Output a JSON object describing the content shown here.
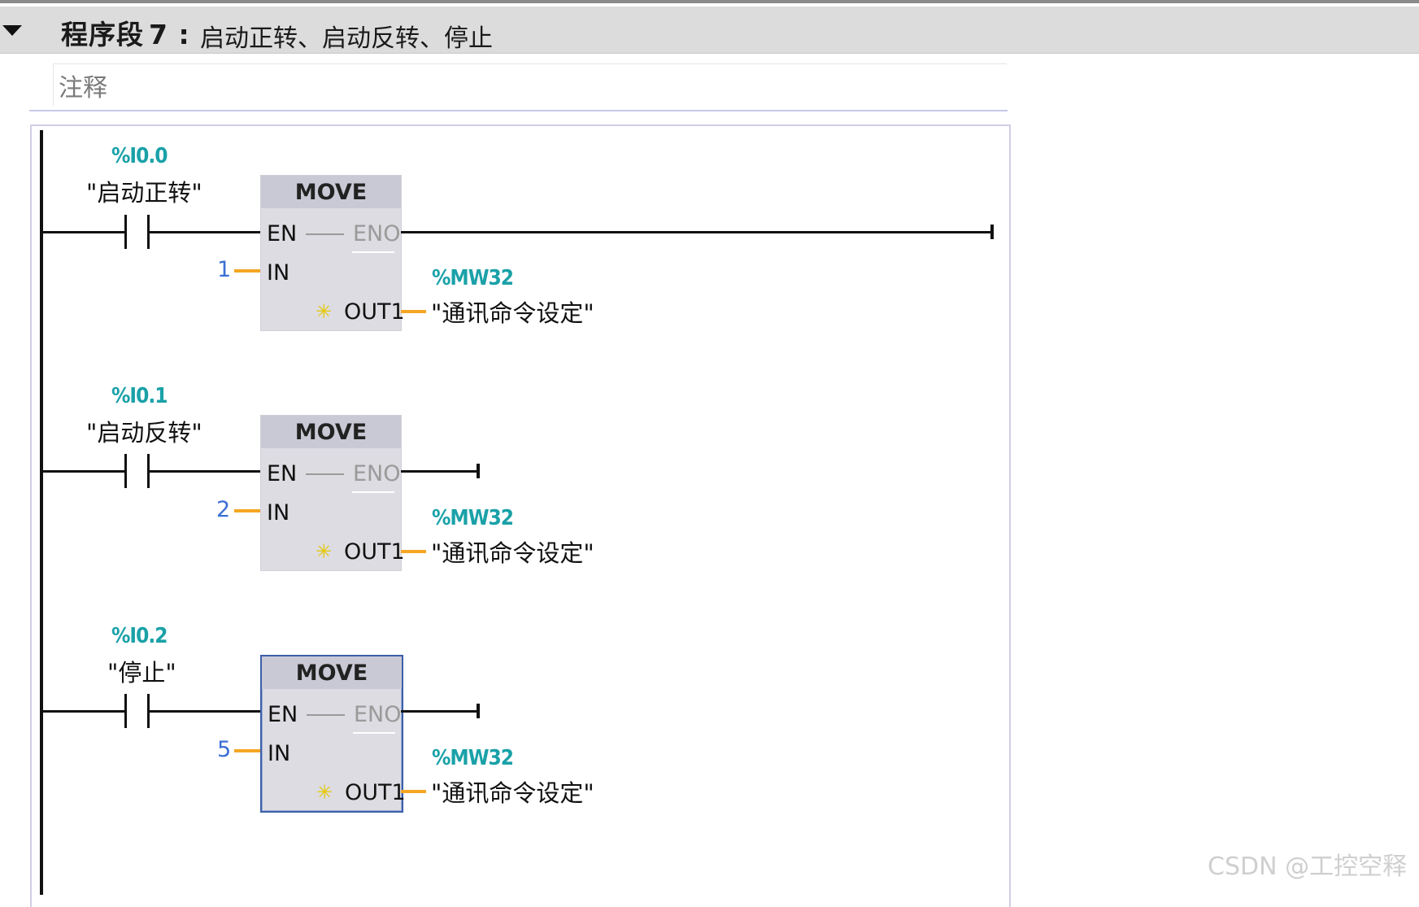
{
  "header": {
    "title": "程序段",
    "number": "7 :",
    "description": "启动正转、启动反转、停止"
  },
  "comment": {
    "label": "注释"
  },
  "rungs": [
    {
      "contact_address": "%I0.0",
      "contact_symbol": "\"启动正转\"",
      "block_title": "MOVE",
      "pin_en": "EN",
      "pin_eno": "ENO",
      "pin_in": "IN",
      "pin_out": "OUT1",
      "in_value": "1",
      "out_address": "%MW32",
      "out_symbol": "\"通讯命令设定\""
    },
    {
      "contact_address": "%I0.1",
      "contact_symbol": "\"启动反转\"",
      "block_title": "MOVE",
      "pin_en": "EN",
      "pin_eno": "ENO",
      "pin_in": "IN",
      "pin_out": "OUT1",
      "in_value": "2",
      "out_address": "%MW32",
      "out_symbol": "\"通讯命令设定\""
    },
    {
      "contact_address": "%I0.2",
      "contact_symbol": "\"停止\"",
      "block_title": "MOVE",
      "pin_en": "EN",
      "pin_eno": "ENO",
      "pin_in": "IN",
      "pin_out": "OUT1",
      "in_value": "5",
      "out_address": "%MW32",
      "out_symbol": "\"通讯命令设定\""
    }
  ],
  "watermark": "CSDN @工控空释",
  "colors": {
    "address": "#1aa1a8",
    "constant": "#3b6fd4",
    "wire_orange": "#f5a623",
    "header_bg": "#dcdcdc",
    "block_bg": "#dcdce2",
    "selected_border": "#3b5fa8"
  }
}
